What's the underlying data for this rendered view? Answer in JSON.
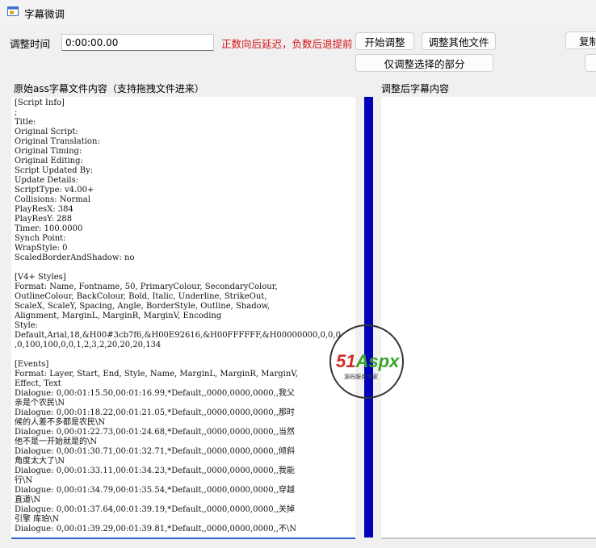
{
  "window": {
    "title": "字幕微调"
  },
  "controls": {
    "time_label": "调整时间",
    "time_value": "0:00:00.00",
    "hint": "正数向后延迟，负数后退提前",
    "start_button": "开始调整",
    "other_files_button": "调整其他文件",
    "selected_only_button": "仅调整选择的部分",
    "copy_button": "复制"
  },
  "panels": {
    "source_label": "原始ass字幕文件内容（支持拖拽文件进来）",
    "result_label": "调整后字幕内容",
    "source_lines": [
      "[Script Info]",
      ";",
      "Title:",
      "Original Script:",
      "Original Translation:",
      "Original Timing:",
      "Original Editing:",
      "Script Updated By:",
      "Update Details:",
      "ScriptType: v4.00+",
      "Collisions: Normal",
      "PlayResX: 384",
      "PlayResY: 288",
      "Timer: 100.0000",
      "Synch Point:",
      "WrapStyle: 0",
      "ScaledBorderAndShadow: no",
      "",
      "[V4+ Styles]",
      "Format: Name, Fontname, 50, PrimaryColour, SecondaryColour,",
      "OutlineColour, BackColour, Bold, Italic, Underline, StrikeOut,",
      "ScaleX, ScaleY, Spacing, Angle, BorderStyle, Outline, Shadow,",
      "Alignment, MarginL, MarginR, MarginV, Encoding",
      "Style:",
      "Default,Arial,18,&H00#3cb7f6,&H00E92616,&H00FFFFFF,&H00000000,0,0,0",
      ",0,100,100,0,0,1,2,3,2,20,20,20,134",
      "",
      "[Events]",
      "Format: Layer, Start, End, Style, Name, MarginL, MarginR, MarginV,",
      "Effect, Text",
      "Dialogue: 0,00:01:15.50,00:01:16.99,*Default,,0000,0000,0000,,我父",
      "亲是个农民\\N",
      "Dialogue: 0,00:01:18.22,00:01:21.05,*Default,,0000,0000,0000,,那时",
      "候的人差不多都是农民\\N",
      "Dialogue: 0,00:01:22.73,00:01:24.68,*Default,,0000,0000,0000,,当然",
      "他不是一开始就是的\\N",
      "Dialogue: 0,00:01:30.71,00:01:32.71,*Default,,0000,0000,0000,,倾斜",
      "角度太大了\\N",
      "Dialogue: 0,00:01:33.11,00:01:34.23,*Default,,0000,0000,0000,,我能",
      "行\\N",
      "Dialogue: 0,00:01:34.79,00:01:35.54,*Default,,0000,0000,0000,,穿越",
      "直道\\N",
      "Dialogue: 0,00:01:37.64,00:01:39.19,*Default,,0000,0000,0000,,关掉",
      "引擎 库珀\\N",
      "Dialogue: 0,00:01:39.29,00:01:39.81,*Default,,0000,0000,0000,,不\\N"
    ]
  },
  "watermark": {
    "brand_num": "51",
    "brand_text": "Aspx",
    "tagline": "源码服务专家"
  }
}
